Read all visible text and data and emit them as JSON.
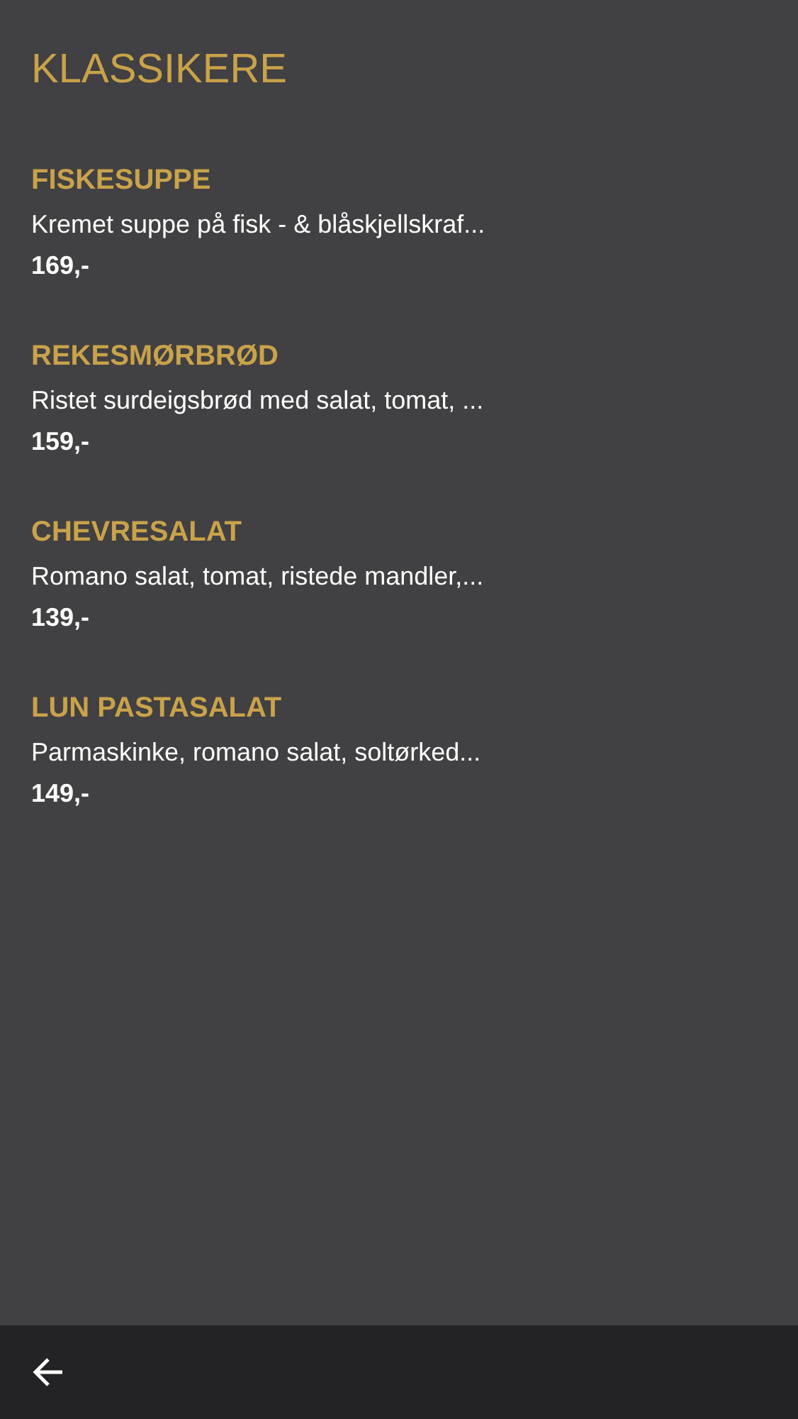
{
  "title": "KLASSIKERE",
  "items": [
    {
      "name": "FISKESUPPE",
      "description": "Kremet suppe på fisk - & blåskjellskraf...",
      "price": "169,-"
    },
    {
      "name": "REKESMØRBRØD",
      "description": "Ristet surdeigsbrød med salat, tomat, ...",
      "price": "159,-"
    },
    {
      "name": "CHEVRESALAT",
      "description": "Romano salat, tomat, ristede mandler,...",
      "price": "139,-"
    },
    {
      "name": "LUN PASTASALAT",
      "description": "Parmaskinke, romano salat, soltørked...",
      "price": "149,-"
    }
  ]
}
